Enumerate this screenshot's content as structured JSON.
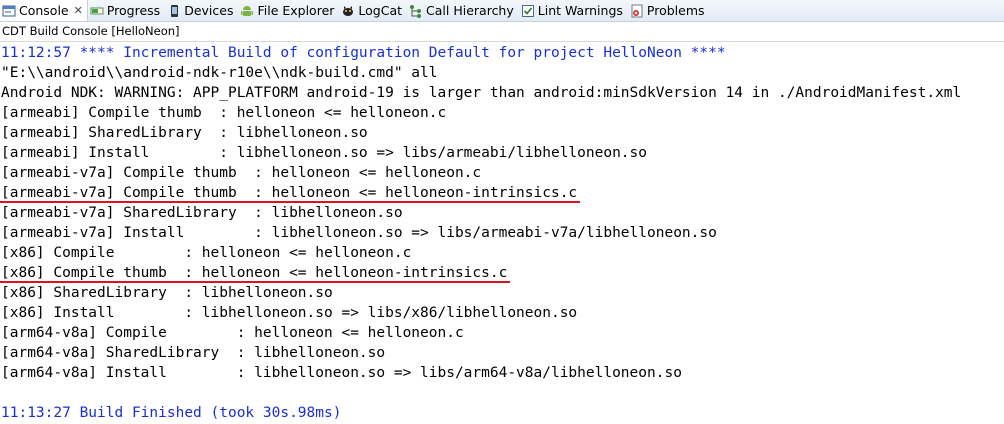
{
  "tabs": [
    {
      "label": "Console",
      "icon": "console-icon",
      "active": true,
      "closable": true
    },
    {
      "label": "Progress",
      "icon": "progress-icon"
    },
    {
      "label": "Devices",
      "icon": "phone-icon"
    },
    {
      "label": "File Explorer",
      "icon": "android-icon"
    },
    {
      "label": "LogCat",
      "icon": "logcat-icon"
    },
    {
      "label": "Call Hierarchy",
      "icon": "call-hierarchy-icon"
    },
    {
      "label": "Lint Warnings",
      "icon": "checkbox-icon"
    },
    {
      "label": "Problems",
      "icon": "problems-icon"
    }
  ],
  "console_title": "CDT Build Console [HelloNeon]",
  "lines": [
    {
      "text": "11:12:57 **** Incremental Build of configuration Default for project HelloNeon ****",
      "kind": "info"
    },
    {
      "text": "\"E:\\\\android\\\\android-ndk-r10e\\\\ndk-build.cmd\" all",
      "kind": "normal"
    },
    {
      "text": "Android NDK: WARNING: APP_PLATFORM android-19 is larger than android:minSdkVersion 14 in ./AndroidManifest.xml",
      "kind": "normal"
    },
    {
      "text": "[armeabi] Compile thumb  : helloneon <= helloneon.c",
      "kind": "normal"
    },
    {
      "text": "[armeabi] SharedLibrary  : libhelloneon.so",
      "kind": "normal"
    },
    {
      "text": "[armeabi] Install        : libhelloneon.so => libs/armeabi/libhelloneon.so",
      "kind": "normal"
    },
    {
      "text": "[armeabi-v7a] Compile thumb  : helloneon <= helloneon.c",
      "kind": "normal"
    },
    {
      "text": "[armeabi-v7a] Compile thumb  : helloneon <= helloneon-intrinsics.c",
      "kind": "normal",
      "highlighted": true
    },
    {
      "text": "[armeabi-v7a] SharedLibrary  : libhelloneon.so",
      "kind": "normal"
    },
    {
      "text": "[armeabi-v7a] Install        : libhelloneon.so => libs/armeabi-v7a/libhelloneon.so",
      "kind": "normal"
    },
    {
      "text": "[x86] Compile        : helloneon <= helloneon.c",
      "kind": "normal"
    },
    {
      "text": "[x86] Compile thumb  : helloneon <= helloneon-intrinsics.c",
      "kind": "normal",
      "highlighted": true
    },
    {
      "text": "[x86] SharedLibrary  : libhelloneon.so",
      "kind": "normal"
    },
    {
      "text": "[x86] Install        : libhelloneon.so => libs/x86/libhelloneon.so",
      "kind": "normal"
    },
    {
      "text": "[arm64-v8a] Compile        : helloneon <= helloneon.c",
      "kind": "normal"
    },
    {
      "text": "[arm64-v8a] SharedLibrary  : libhelloneon.so",
      "kind": "normal"
    },
    {
      "text": "[arm64-v8a] Install        : libhelloneon.so => libs/arm64-v8a/libhelloneon.so",
      "kind": "normal"
    },
    {
      "text": "",
      "kind": "normal"
    },
    {
      "text": "11:13:27 Build Finished (took 30s.98ms)",
      "kind": "info"
    }
  ],
  "colors": {
    "info": "#1a2fd1",
    "highlight_underline": "#d8141c"
  }
}
